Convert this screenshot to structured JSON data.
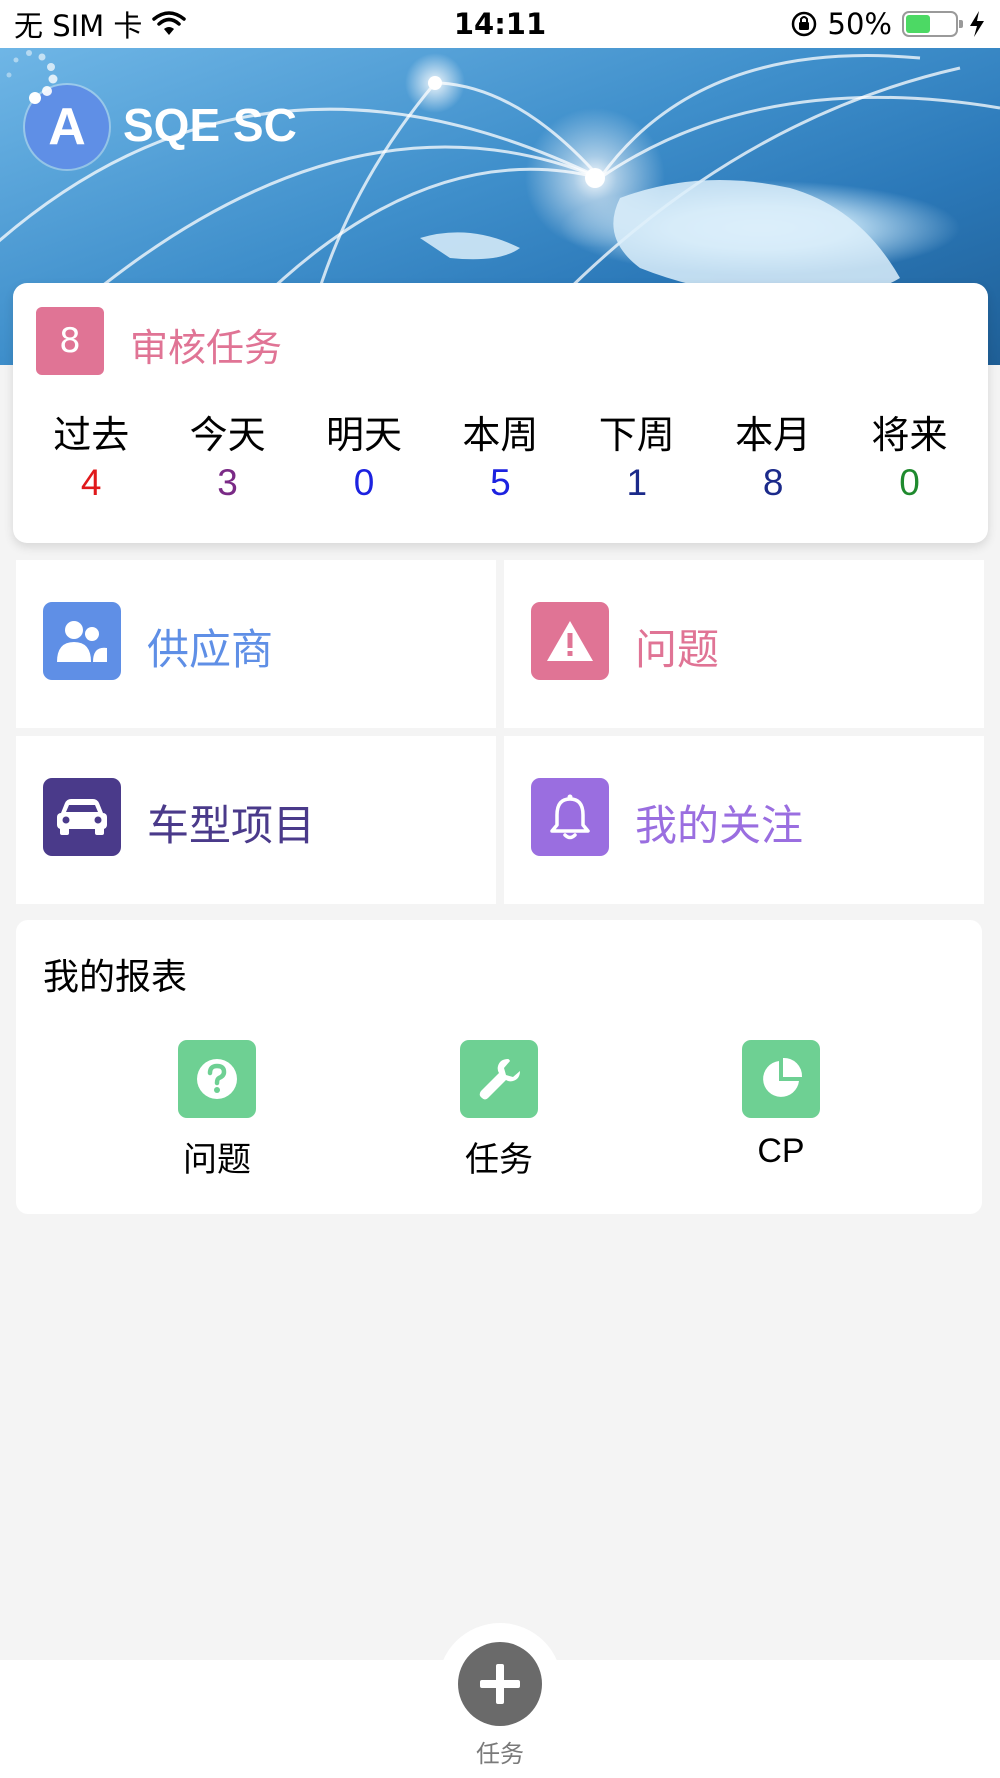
{
  "status_bar": {
    "carrier": "无 SIM 卡",
    "time": "14:11",
    "battery": "50%",
    "battery_level": 0.5
  },
  "header": {
    "avatar_letter": "A",
    "app_title": "SQE SC",
    "icons": [
      "wifi-icon",
      "orientation-lock-icon",
      "battery-icon",
      "charging-icon",
      "loading-spinner-icon"
    ]
  },
  "audit_tasks": {
    "count": "8",
    "title": "审核任务",
    "periods": [
      {
        "label": "过去",
        "count": "4",
        "color": "#e0191b"
      },
      {
        "label": "今天",
        "count": "3",
        "color": "#7a2a86"
      },
      {
        "label": "明天",
        "count": "0",
        "color": "#1c22e0"
      },
      {
        "label": "本周",
        "count": "5",
        "color": "#1c22e0"
      },
      {
        "label": "下周",
        "count": "1",
        "color": "#1b2a8a"
      },
      {
        "label": "本月",
        "count": "8",
        "color": "#1b2a8a"
      },
      {
        "label": "将来",
        "count": "0",
        "color": "#1f8a2e"
      }
    ]
  },
  "tiles": {
    "supplier": {
      "label": "供应商",
      "icon": "users-icon",
      "color": "#5f8fe6",
      "text_color": "#5f8fe6"
    },
    "issue": {
      "label": "问题",
      "icon": "warning-icon",
      "color": "#e07495",
      "text_color": "#e07495"
    },
    "vehicle_project": {
      "label": "车型项目",
      "icon": "car-icon",
      "color": "#4a3a8a",
      "text_color": "#4a3a8a"
    },
    "my_follow": {
      "label": "我的关注",
      "icon": "bell-icon",
      "color": "#9a6ee0",
      "text_color": "#9a6ee0"
    }
  },
  "reports": {
    "title": "我的报表",
    "color": "#6ed093",
    "items": [
      {
        "label": "问题",
        "icon": "question-icon"
      },
      {
        "label": "任务",
        "icon": "wrench-icon"
      },
      {
        "label": "CP",
        "icon": "pie-chart-icon"
      }
    ]
  },
  "bottom_nav": {
    "fab_label": "任务",
    "fab_icon": "plus-icon"
  }
}
